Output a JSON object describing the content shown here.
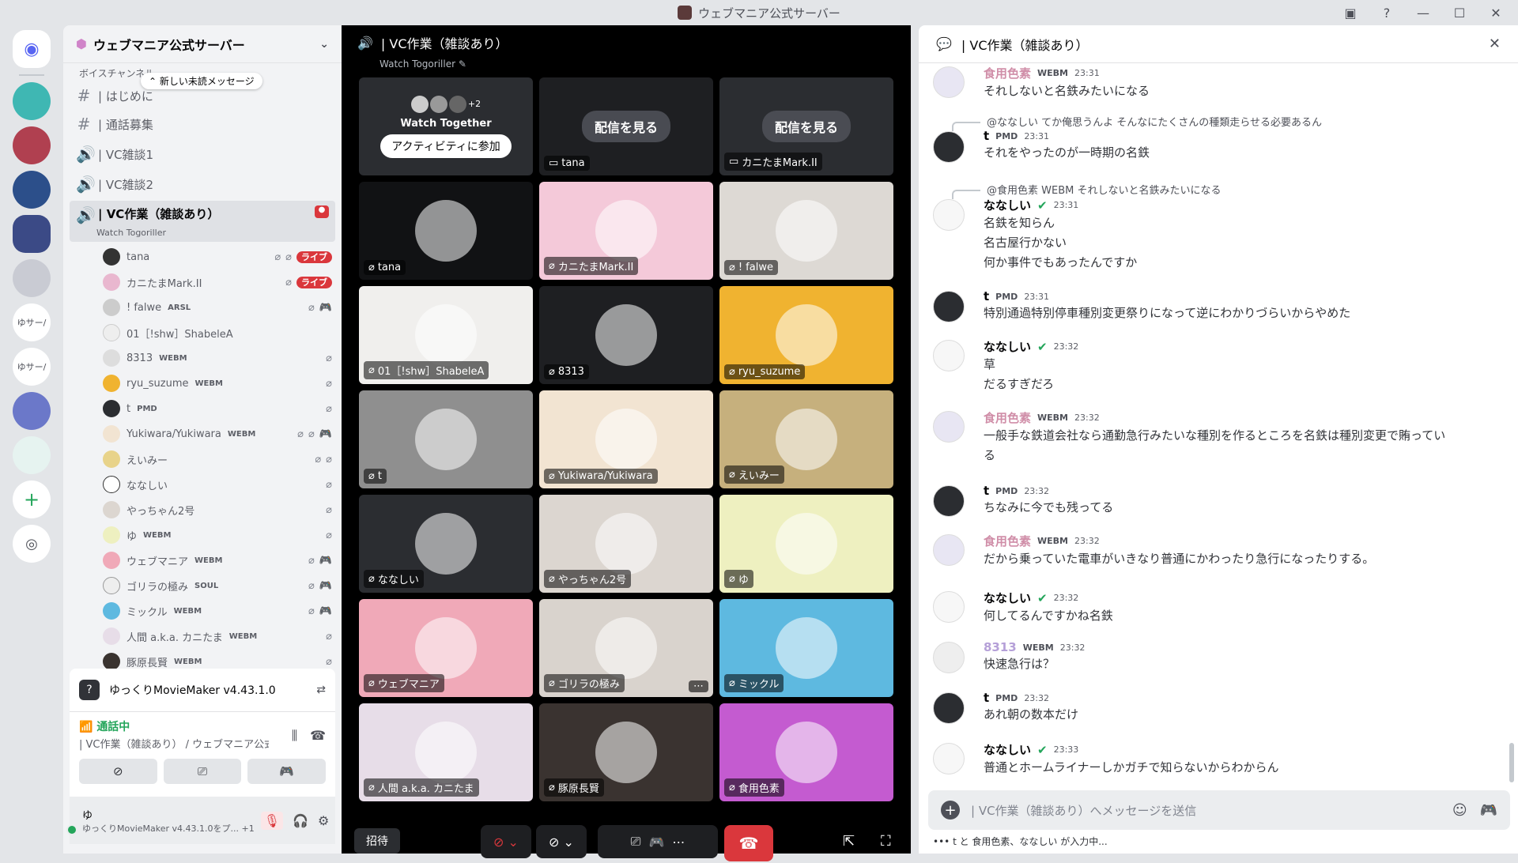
{
  "window": {
    "title": "ウェブマニア公式サーバー"
  },
  "rail": {
    "labels": [
      "ゆサー/",
      "ゆサー/"
    ]
  },
  "sidebar": {
    "server_name": "ウェブマニア公式サーバー",
    "category": "ボイスチャンネル",
    "new_unread": "新しい未読メッセージ",
    "channels": [
      {
        "label": "| はじめに"
      },
      {
        "label": "| 通話募集"
      },
      {
        "label": "| VC雑談1"
      },
      {
        "label": "| VC雑談2"
      },
      {
        "label": "| VC作業（雑談あり）",
        "sub": "Watch Togoriller"
      }
    ],
    "members": [
      {
        "name": "tana",
        "tag": "",
        "live": "ライブ"
      },
      {
        "name": "カニたまMark.II",
        "tag": "",
        "live": "ライブ"
      },
      {
        "name": "! falwe",
        "tag": "ARSL",
        "live": ""
      },
      {
        "name": "01［!shw］ShabeleA",
        "tag": "",
        "live": ""
      },
      {
        "name": "8313",
        "tag": "WEBM",
        "live": ""
      },
      {
        "name": "ryu_suzume",
        "tag": "WEBM",
        "live": ""
      },
      {
        "name": "t",
        "tag": "PMD",
        "live": ""
      },
      {
        "name": "Yukiwara/Yukiwara",
        "tag": "WEBM",
        "live": ""
      },
      {
        "name": "えいみー",
        "tag": "",
        "live": ""
      },
      {
        "name": "ななしい",
        "tag": "",
        "live": ""
      },
      {
        "name": "やっちゃん2号",
        "tag": "",
        "live": ""
      },
      {
        "name": "ゆ",
        "tag": "WEBM",
        "live": ""
      },
      {
        "name": "ウェブマニア",
        "tag": "WEBM",
        "live": ""
      },
      {
        "name": "ゴリラの極み",
        "tag": "SOUL",
        "live": ""
      },
      {
        "name": "ミックル",
        "tag": "WEBM",
        "live": ""
      },
      {
        "name": "人間 a.k.a. カニたま",
        "tag": "WEBM",
        "live": ""
      },
      {
        "name": "豚原長賢",
        "tag": "WEBM",
        "live": ""
      }
    ],
    "activity": "ゆっくりMovieMaker v4.43.1.0",
    "voice_status": "通話中",
    "voice_channel": "| VC作業（雑談あり） / ウェブマニア公式サ...",
    "user_name": "ゆ",
    "user_status": "ゆっくりMovieMaker v4.43.1.0をプ...",
    "user_extra": "+1"
  },
  "stage": {
    "title": "| VC作業（雑談あり）",
    "subtitle": "Watch Togoriller",
    "watch_together": {
      "count": "+2",
      "title": "Watch Together",
      "join": "アクティビティに参加"
    },
    "watch_stream": "配信を見る",
    "tiles": [
      {
        "name": "tana",
        "color": "#1e1f22"
      },
      {
        "name": "カニたまMark.II",
        "color": "#2b2d31"
      },
      {
        "name": "tana",
        "color": "#111214"
      },
      {
        "name": "カニたまMark.II",
        "color": "#f4c9d9"
      },
      {
        "name": "! falwe",
        "color": "#ddd9d4"
      },
      {
        "name": "01［!shw］ShabeleA",
        "color": "#f0efed"
      },
      {
        "name": "8313",
        "color": "#1e1f22"
      },
      {
        "name": "ryu_suzume",
        "color": "#f0b330"
      },
      {
        "name": "t",
        "color": "#8f8f8f"
      },
      {
        "name": "Yukiwara/Yukiwara",
        "color": "#f2e4d2"
      },
      {
        "name": "えいみー",
        "color": "#c6b07d"
      },
      {
        "name": "ななしい",
        "color": "#2b2d31"
      },
      {
        "name": "やっちゃん2号",
        "color": "#dcd6d0"
      },
      {
        "name": "ゆ",
        "color": "#eef0c0"
      },
      {
        "name": "ウェブマニア",
        "color": "#f0a9b8"
      },
      {
        "name": "ゴリラの極み",
        "color": "#d9d3cd"
      },
      {
        "name": "ミックル",
        "color": "#5eb9e0"
      },
      {
        "name": "人間 a.k.a. カニたま",
        "color": "#e7dde8"
      },
      {
        "name": "豚原長賢",
        "color": "#3a3330"
      },
      {
        "name": "食用色素",
        "color": "#c45bd0"
      }
    ],
    "invite": "招待"
  },
  "chat": {
    "title": "| VC作業（雑談あり）",
    "messages": [
      {
        "author": "食用色素",
        "tag": "WEBM",
        "time": "23:31",
        "lines": [
          "それしないと名鉄みたいになる"
        ]
      },
      {
        "reply": "@ななしい てか俺思うんよ そんなにたくさんの種類走らせる必要あるん",
        "author": "t",
        "tag": "PMD",
        "time": "23:31",
        "lines": [
          "それをやったのが一時期の名鉄"
        ]
      },
      {
        "reply": "@食用色素 WEBM それしないと名鉄みたいになる",
        "author": "ななしい",
        "tag": "",
        "time": "23:31",
        "lines": [
          "名鉄を知らん",
          "名古屋行かない",
          "何か事件でもあったんですか"
        ]
      },
      {
        "author": "t",
        "tag": "PMD",
        "time": "23:31",
        "lines": [
          "特別通過特別停車種別変更祭りになって逆にわかりづらいからやめた"
        ]
      },
      {
        "author": "ななしい",
        "tag": "",
        "time": "23:32",
        "lines": [
          "草",
          "だるすぎだろ"
        ]
      },
      {
        "author": "食用色素",
        "tag": "WEBM",
        "time": "23:32",
        "lines": [
          "一般手な鉄道会社なら通勤急行みたいな種別を作るところを名鉄は種別変更で賄ってい",
          "る"
        ]
      },
      {
        "author": "t",
        "tag": "PMD",
        "time": "23:32",
        "lines": [
          "ちなみに今でも残ってる"
        ]
      },
      {
        "author": "食用色素",
        "tag": "WEBM",
        "time": "23:32",
        "lines": [
          "だから乗っていた電車がいきなり普通にかわったり急行になったりする。"
        ]
      },
      {
        "author": "ななしい",
        "tag": "",
        "time": "23:32",
        "lines": [
          "何してるんですかね名鉄"
        ]
      },
      {
        "author": "8313",
        "tag": "WEBM",
        "time": "23:32",
        "lines": [
          "快速急行は？"
        ]
      },
      {
        "author": "t",
        "tag": "PMD",
        "time": "23:32",
        "lines": [
          "あれ朝の数本だけ"
        ]
      },
      {
        "author": "ななしい",
        "tag": "",
        "time": "23:33",
        "lines": [
          "普通とホームライナーしかガチで知らないからわからん"
        ]
      }
    ],
    "placeholder": "| VC作業（雑談あり）へメッセージを送信",
    "typing": "t と 食用色素、ななしい が入力中..."
  }
}
